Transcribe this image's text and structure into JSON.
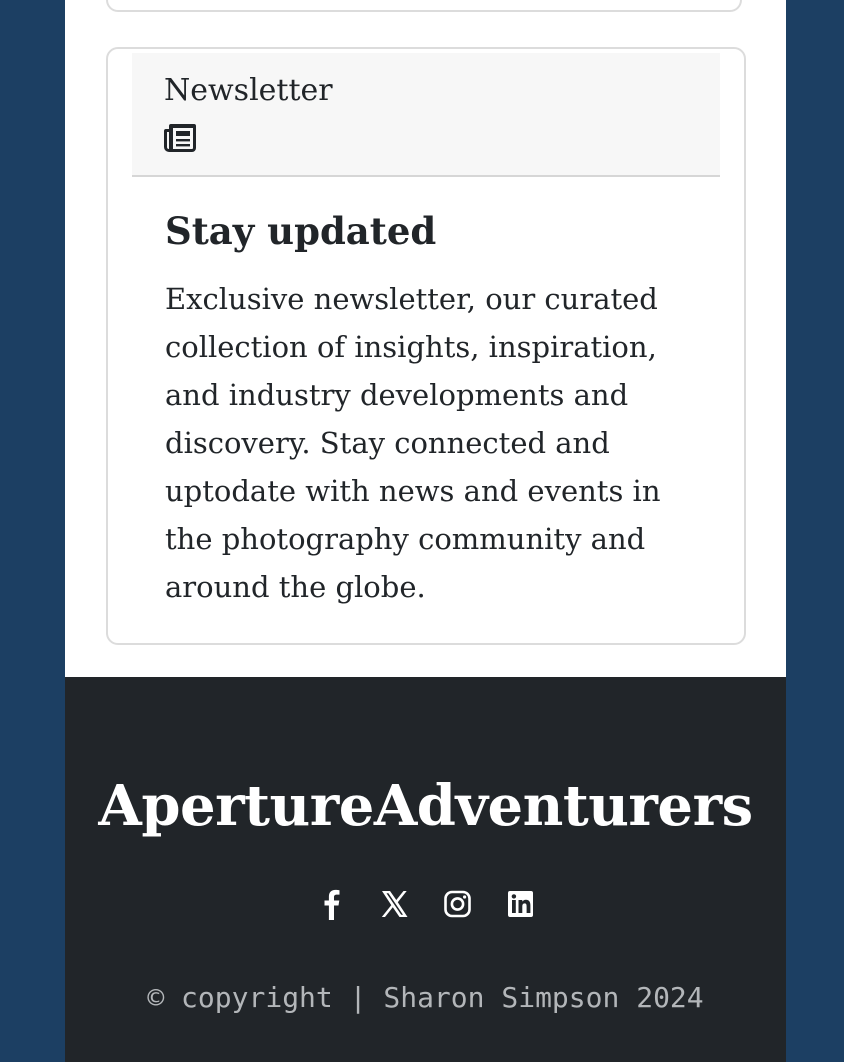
{
  "newsletter": {
    "header_title": "Newsletter",
    "header_icon": "newspaper-icon",
    "title": "Stay updated",
    "text": "Exclusive newsletter, our curated collection of insights, inspiration, and industry developments and discovery. Stay connected and uptodate with news and events in the photography community and around the globe."
  },
  "footer": {
    "brand": "ApertureAdventurers",
    "social": [
      {
        "icon": "facebook-icon"
      },
      {
        "icon": "x-twitter-icon"
      },
      {
        "icon": "instagram-icon"
      },
      {
        "icon": "linkedin-icon"
      }
    ],
    "copyright": "© copyright | Sharon Simpson 2024"
  },
  "colors": {
    "background": "#1c3f63",
    "footer": "#212529",
    "card_header": "#f7f7f7"
  }
}
